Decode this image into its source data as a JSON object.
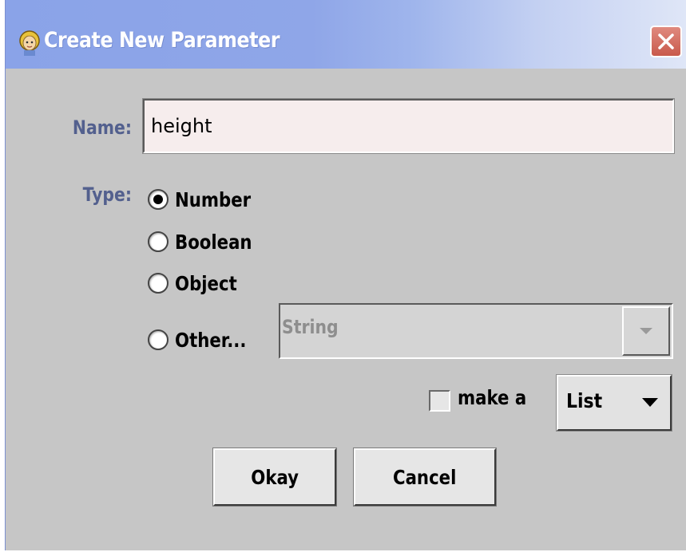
{
  "window": {
    "title": "Create New Parameter",
    "icon": "app-character-icon",
    "close_icon": "close-icon"
  },
  "name_field": {
    "label": "Name:",
    "value": "height"
  },
  "type": {
    "label": "Type:",
    "options": [
      {
        "label": "Number",
        "selected": true
      },
      {
        "label": "Boolean",
        "selected": false
      },
      {
        "label": "Object",
        "selected": false
      },
      {
        "label": "Other...",
        "selected": false
      }
    ],
    "other_combo": {
      "value": "String",
      "enabled": false
    }
  },
  "make_list": {
    "checkbox_label": "make a",
    "checked": false,
    "collection_type": "List"
  },
  "buttons": {
    "okay": "Okay",
    "cancel": "Cancel"
  },
  "colors": {
    "title_bar_start": "#8aa3e8",
    "title_bar_end": "#dfe6f7",
    "label_text": "#53608e",
    "window_bg": "#c6c6c6",
    "close_button": "#d06c5f",
    "field_bg": "#f6eded"
  }
}
